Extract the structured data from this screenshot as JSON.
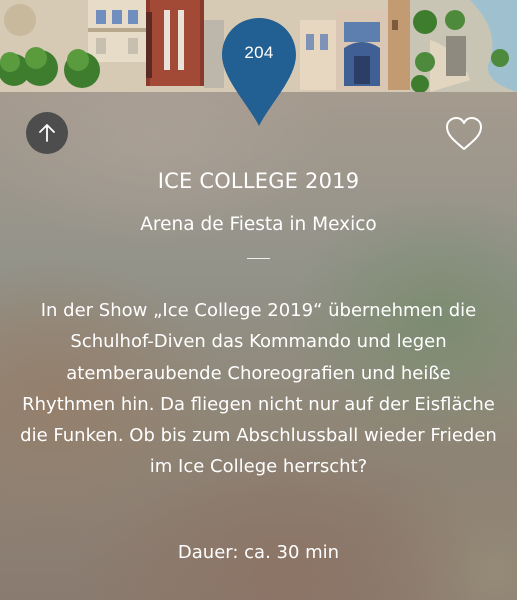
{
  "map": {
    "pin_number": "204",
    "pin_color": "#225f92"
  },
  "actions": {
    "up_icon": "arrow-up-icon",
    "favorite_icon": "heart-outline-icon"
  },
  "show": {
    "title": "ICE COLLEGE 2019",
    "venue": "Arena de Fiesta in Mexico",
    "description": "In der Show „Ice College 2019“ übernehmen die Schulhof-Diven das Kommando und legen atemberaubende Choreografien und heiße Rhythmen hin. Da fliegen nicht nur auf der Eisfläche die Funken. Ob bis zum Abschlussball wieder Frieden im Ice College herrscht?",
    "duration": "Dauer: ca. 30 min"
  }
}
